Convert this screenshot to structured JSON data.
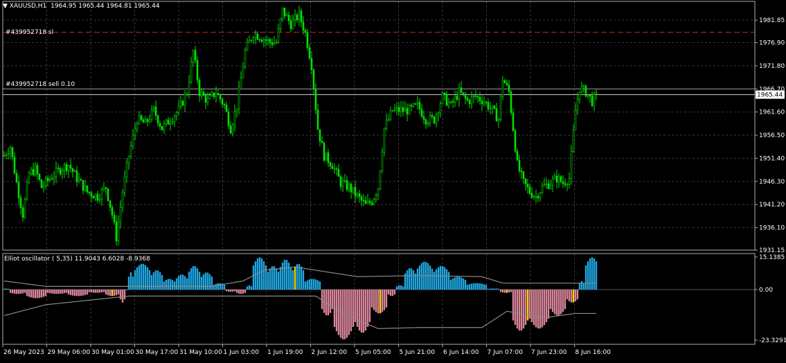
{
  "symbol_header": {
    "arrow": "▼",
    "symbol": "XAUUSD,H1",
    "ohlc": "1964.95 1965.44 1964.81 1965.44"
  },
  "price_axis": {
    "ticks": [
      "1981.85",
      "1976.90",
      "1971.80",
      "1966.70",
      "1961.60",
      "1956.50",
      "1951.40",
      "1946.30",
      "1941.20",
      "1936.10",
      "1931.15"
    ],
    "current_price": "1965.44"
  },
  "orders": {
    "sl_label": "#439952718 sl",
    "sl_price": 1979.2,
    "entry_label": "#439952718 sell 0.10",
    "entry_price": 1966.7
  },
  "oscillator": {
    "title": "Elliot oscillator ( 5,35) 11.9043 6.6028 -8.9368",
    "axis_ticks": [
      "15.1385",
      "0.00",
      "-23.3291"
    ]
  },
  "time_axis": {
    "labels": [
      "26 May 2023",
      "29 May 06:00",
      "30 May 01:00",
      "30 May 17:00",
      "31 May 10:00",
      "1 Jun 03:00",
      "1 Jun 19:00",
      "2 Jun 12:00",
      "5 Jun 05:00",
      "5 Jun 21:00",
      "6 Jun 14:00",
      "7 Jun 07:00",
      "7 Jun 23:00",
      "8 Jun 16:00"
    ]
  },
  "colors": {
    "background": "#000000",
    "grid": "#3a3a3a",
    "candle": "#00e000",
    "sl_line": "#d02020",
    "entry_line": "#9a9a9a",
    "osc_positive": "#1fa6e0",
    "osc_negative": "#d9849a",
    "osc_highlight": "#ffd700",
    "osc_lines": "#8a8a8a"
  },
  "chart_data": [
    {
      "type": "candlestick",
      "ylim": [
        1931.15,
        1986.0
      ],
      "path": [
        [
          0,
          1952
        ],
        [
          3,
          1954
        ],
        [
          6,
          1946
        ],
        [
          9,
          1939
        ],
        [
          12,
          1948
        ],
        [
          15,
          1949
        ],
        [
          18,
          1945
        ],
        [
          22,
          1947
        ],
        [
          27,
          1949
        ],
        [
          31,
          1950
        ],
        [
          35,
          1947
        ],
        [
          40,
          1944
        ],
        [
          45,
          1943
        ],
        [
          49,
          1945
        ],
        [
          52,
          1939
        ],
        [
          54,
          1934
        ],
        [
          57,
          1944
        ],
        [
          60,
          1952
        ],
        [
          64,
          1960
        ],
        [
          68,
          1959
        ],
        [
          72,
          1962
        ],
        [
          76,
          1958
        ],
        [
          80,
          1960
        ],
        [
          84,
          1962
        ],
        [
          88,
          1966
        ],
        [
          91,
          1975
        ],
        [
          94,
          1966
        ],
        [
          98,
          1964
        ],
        [
          102,
          1966
        ],
        [
          106,
          1963
        ],
        [
          109,
          1958
        ],
        [
          112,
          1963
        ],
        [
          116,
          1975
        ],
        [
          120,
          1979
        ],
        [
          124,
          1978
        ],
        [
          128,
          1977
        ],
        [
          131,
          1977
        ],
        [
          134,
          1984
        ],
        [
          138,
          1981
        ],
        [
          142,
          1983
        ],
        [
          145,
          1979
        ],
        [
          148,
          1972
        ],
        [
          151,
          1958
        ],
        [
          154,
          1952
        ],
        [
          158,
          1950
        ],
        [
          162,
          1946
        ],
        [
          166,
          1945
        ],
        [
          170,
          1943
        ],
        [
          174,
          1941
        ],
        [
          177,
          1942
        ],
        [
          180,
          1945
        ],
        [
          183,
          1958
        ],
        [
          187,
          1962
        ],
        [
          191,
          1962
        ],
        [
          195,
          1962
        ],
        [
          199,
          1963
        ],
        [
          203,
          1960
        ],
        [
          207,
          1960
        ],
        [
          211,
          1965
        ],
        [
          215,
          1963
        ],
        [
          219,
          1966
        ],
        [
          223,
          1964
        ],
        [
          227,
          1965
        ],
        [
          231,
          1964
        ],
        [
          235,
          1962
        ],
        [
          238,
          1960
        ],
        [
          240,
          1969
        ],
        [
          243,
          1966
        ],
        [
          245,
          1958
        ],
        [
          247,
          1950
        ],
        [
          250,
          1946
        ],
        [
          253,
          1944
        ],
        [
          256,
          1943
        ],
        [
          259,
          1945
        ],
        [
          263,
          1946
        ],
        [
          266,
          1947
        ],
        [
          269,
          1946
        ],
        [
          272,
          1947
        ],
        [
          275,
          1962
        ],
        [
          277,
          1967
        ],
        [
          280,
          1966
        ],
        [
          283,
          1964
        ],
        [
          285,
          1965
        ]
      ]
    },
    {
      "type": "bar",
      "title": "Elliot oscillator ( 5,35)",
      "ylim": [
        -23.3291,
        15.1385
      ],
      "sections": [
        [
          0,
          2,
          0.5
        ],
        [
          3,
          10,
          -2
        ],
        [
          11,
          20,
          -4
        ],
        [
          21,
          30,
          -2
        ],
        [
          31,
          40,
          -3
        ],
        [
          41,
          48,
          -1.5
        ],
        [
          49,
          55,
          -3
        ],
        [
          56,
          58,
          -6
        ],
        [
          60,
          62,
          8
        ],
        [
          63,
          70,
          12
        ],
        [
          71,
          76,
          9
        ],
        [
          77,
          82,
          5
        ],
        [
          83,
          88,
          7
        ],
        [
          89,
          94,
          11
        ],
        [
          95,
          100,
          8
        ],
        [
          101,
          106,
          3
        ],
        [
          107,
          111,
          -1
        ],
        [
          112,
          116,
          -2
        ],
        [
          117,
          119,
          2
        ],
        [
          120,
          126,
          15
        ],
        [
          127,
          132,
          11
        ],
        [
          133,
          138,
          14
        ],
        [
          139,
          144,
          12
        ],
        [
          145,
          152,
          5
        ],
        [
          153,
          158,
          -12
        ],
        [
          159,
          168,
          -23
        ],
        [
          169,
          176,
          -20
        ],
        [
          177,
          184,
          -11
        ],
        [
          185,
          188,
          -3
        ],
        [
          189,
          192,
          2
        ],
        [
          193,
          198,
          10
        ],
        [
          199,
          206,
          13
        ],
        [
          207,
          214,
          11
        ],
        [
          215,
          222,
          6
        ],
        [
          223,
          232,
          3
        ],
        [
          233,
          238,
          0.5
        ],
        [
          239,
          244,
          -1.5
        ],
        [
          245,
          252,
          -19
        ],
        [
          253,
          262,
          -18
        ],
        [
          263,
          270,
          -12
        ],
        [
          271,
          276,
          -6
        ],
        [
          277,
          279,
          4
        ],
        [
          280,
          286,
          15
        ]
      ],
      "highlight_indexes": [
        52,
        140,
        181,
        242,
        252,
        274
      ],
      "upper_band": [
        [
          0,
          4
        ],
        [
          20,
          1.5
        ],
        [
          60,
          1.5
        ],
        [
          80,
          1.5
        ],
        [
          100,
          1.5
        ],
        [
          115,
          4
        ],
        [
          125,
          9
        ],
        [
          140,
          10.5
        ],
        [
          170,
          6
        ],
        [
          200,
          6.5
        ],
        [
          230,
          6
        ],
        [
          240,
          3
        ],
        [
          286,
          3
        ]
      ],
      "lower_band": [
        [
          0,
          -12
        ],
        [
          20,
          -7
        ],
        [
          40,
          -5
        ],
        [
          60,
          -3
        ],
        [
          100,
          -3
        ],
        [
          150,
          -3
        ],
        [
          165,
          -12
        ],
        [
          180,
          -18
        ],
        [
          200,
          -17.5
        ],
        [
          230,
          -17.5
        ],
        [
          242,
          -10
        ],
        [
          260,
          -13
        ],
        [
          275,
          -11
        ],
        [
          285,
          -11
        ]
      ]
    }
  ]
}
